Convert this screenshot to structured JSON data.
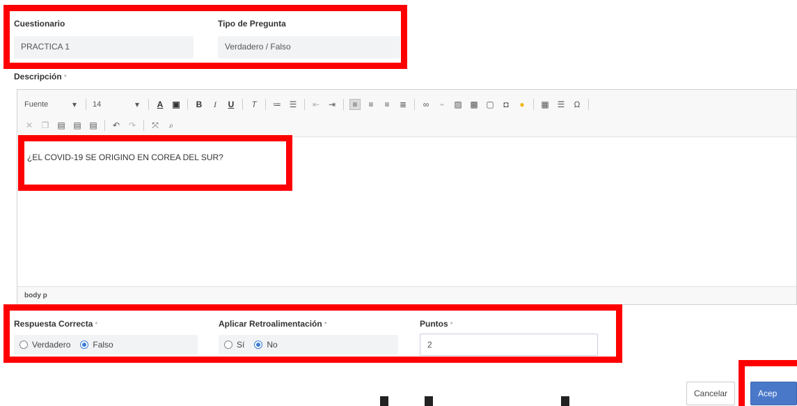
{
  "quiz": {
    "label": "Cuestionario",
    "value": "PRACTICA 1"
  },
  "question_type": {
    "label": "Tipo de Pregunta",
    "value": "Verdadero / Falso"
  },
  "description": {
    "label": "Descripción",
    "required": "*",
    "font_label": "Fuente",
    "font_size": "14",
    "content": "¿EL COVID-19 SE ORIGINO EN COREA DEL SUR?",
    "statusbar": "body  p"
  },
  "correct_answer": {
    "label": "Respuesta Correcta",
    "required": "*",
    "options": [
      "Verdadero",
      "Falso"
    ],
    "selected": "Falso"
  },
  "feedback": {
    "label": "Aplicar Retroalimentación",
    "required": "*",
    "options": [
      "Sí",
      "No"
    ],
    "selected": "No"
  },
  "points": {
    "label": "Puntos",
    "required": "*",
    "value": "2"
  },
  "buttons": {
    "cancel": "Cancelar",
    "accept": "Acep"
  },
  "colors": {
    "highlight": "#ff0000",
    "accent": "#4a78c9"
  }
}
